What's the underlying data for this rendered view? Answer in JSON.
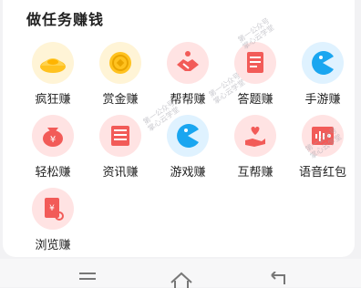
{
  "section": {
    "title": "做任务赚钱"
  },
  "items": [
    {
      "label": "疯狂赚",
      "icon": "gold-ingot-icon",
      "bg": "#fff4d6",
      "accent": "#ffc21f"
    },
    {
      "label": "赏金赚",
      "icon": "gold-coin-icon",
      "bg": "#fff4d6",
      "accent": "#ffc21f"
    },
    {
      "label": "帮帮赚",
      "icon": "handshake-icon",
      "bg": "#ffe3e3",
      "accent": "#f25b58"
    },
    {
      "label": "答题赚",
      "icon": "quiz-sheet-icon",
      "bg": "#ffe3e3",
      "accent": "#f25b58"
    },
    {
      "label": "手游赚",
      "icon": "pacman-icon",
      "bg": "#dff2ff",
      "accent": "#1aa6f0"
    },
    {
      "label": "轻松赚",
      "icon": "money-bag-icon",
      "bg": "#ffe3e3",
      "accent": "#f25b58"
    },
    {
      "label": "资讯赚",
      "icon": "news-icon",
      "bg": "#ffe3e3",
      "accent": "#f25b58"
    },
    {
      "label": "游戏赚",
      "icon": "pacman-icon",
      "bg": "#dff2ff",
      "accent": "#1aa6f0"
    },
    {
      "label": "互帮赚",
      "icon": "hand-heart-icon",
      "bg": "#ffe3e3",
      "accent": "#f25b58"
    },
    {
      "label": "语音红包",
      "icon": "voice-envelope-icon",
      "bg": "#ffe3e3",
      "accent": "#f25b58"
    },
    {
      "label": "浏览赚",
      "icon": "browse-doc-icon",
      "bg": "#ffe3e3",
      "accent": "#f25b58"
    }
  ],
  "watermark": {
    "line1": "第一公众号",
    "line2": "掌心云学堂"
  },
  "navbar": {
    "buttons": [
      "menu-icon",
      "home-icon",
      "back-icon"
    ]
  }
}
